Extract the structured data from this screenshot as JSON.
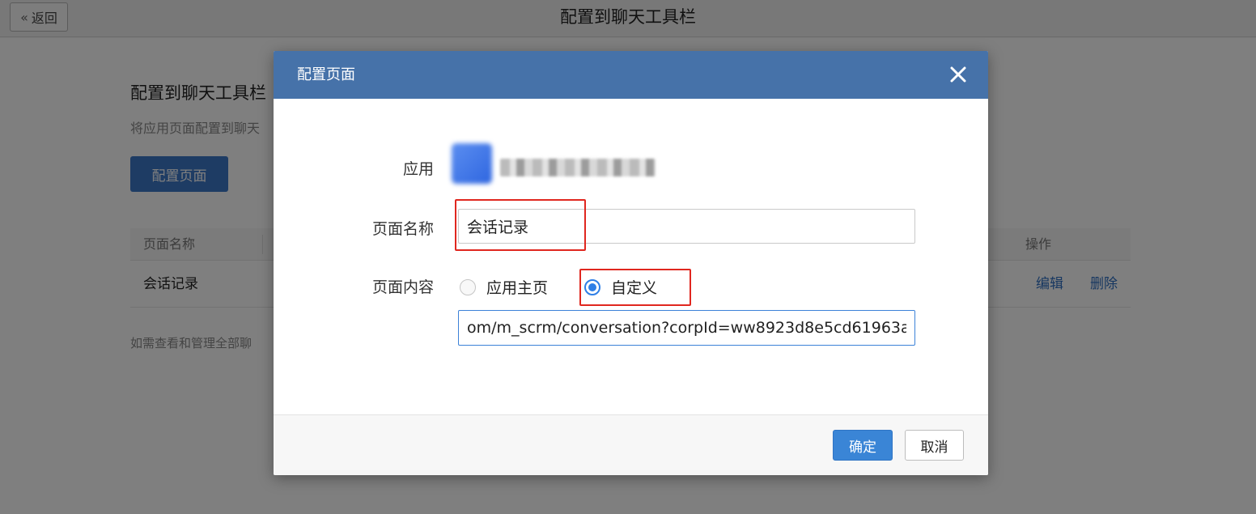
{
  "topbar": {
    "back_label": "返回",
    "title": "配置到聊天工具栏"
  },
  "page": {
    "heading": "配置到聊天工具栏",
    "description": "将应用页面配置到聊天",
    "config_button": "配置页面",
    "table": {
      "headers": {
        "name": "页面名称",
        "actions": "操作"
      },
      "rows": [
        {
          "name": "会话记录",
          "edit": "编辑",
          "delete": "删除"
        }
      ]
    },
    "footnote": "如需查看和管理全部聊"
  },
  "modal": {
    "title": "配置页面",
    "close_icon": "close-icon",
    "app": {
      "label": "应用",
      "icon": "app-icon"
    },
    "page_name": {
      "label": "页面名称",
      "value": "会话记录"
    },
    "page_content": {
      "label": "页面内容",
      "options": [
        {
          "label": "应用主页",
          "checked": false
        },
        {
          "label": "自定义",
          "checked": true
        }
      ],
      "url_value": "om/m_scrm/conversation?corpId=ww8923d8e5cd61963a"
    },
    "buttons": {
      "ok": "确定",
      "cancel": "取消"
    }
  },
  "colors": {
    "modal_header": "#4672a9",
    "primary": "#3a85d6",
    "highlight": "#e0271f",
    "radio_checked": "#2f7fe6"
  }
}
